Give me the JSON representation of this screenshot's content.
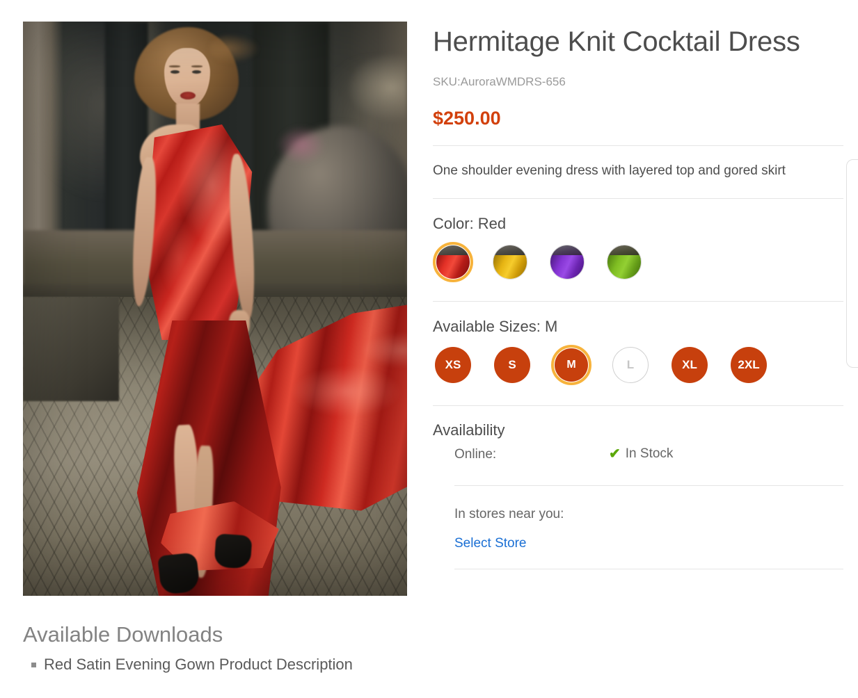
{
  "product": {
    "title": "Hermitage Knit Cocktail Dress",
    "sku": "SKU:AuroraWMDRS-656",
    "price": "$250.00",
    "description": "One shoulder evening dress with layered top and gored skirt",
    "image_alt": "Model in red satin one-shoulder evening gown on cobblestone street"
  },
  "color": {
    "label": "Color: Red",
    "selected": "Red",
    "options": [
      {
        "name": "Red",
        "hex": "#d4211b",
        "selected": true
      },
      {
        "name": "Gold",
        "hex": "#e8b312",
        "selected": false
      },
      {
        "name": "Purple",
        "hex": "#7e30c9",
        "selected": false
      },
      {
        "name": "Green",
        "hex": "#79b524",
        "selected": false
      }
    ]
  },
  "sizes": {
    "label": "Available Sizes: M",
    "selected": "M",
    "options": [
      {
        "label": "XS",
        "state": "available"
      },
      {
        "label": "S",
        "state": "available"
      },
      {
        "label": "M",
        "state": "selected"
      },
      {
        "label": "L",
        "state": "unavailable"
      },
      {
        "label": "XL",
        "state": "available"
      },
      {
        "label": "2XL",
        "state": "available"
      }
    ]
  },
  "availability": {
    "heading": "Availability",
    "online_label": "Online:",
    "online_status": "In Stock",
    "check_icon": "check-icon",
    "stores_label": "In stores near you:",
    "select_store_link": "Select Store"
  },
  "downloads": {
    "heading": "Available Downloads",
    "items": [
      "Red Satin Evening Gown Product Description"
    ]
  },
  "theme": {
    "accent": "#d2400c",
    "selection_ring": "#f7b33c",
    "link": "#1a6fd4",
    "in_stock_green": "#5ca80a",
    "divider": "#e5e5e5"
  }
}
